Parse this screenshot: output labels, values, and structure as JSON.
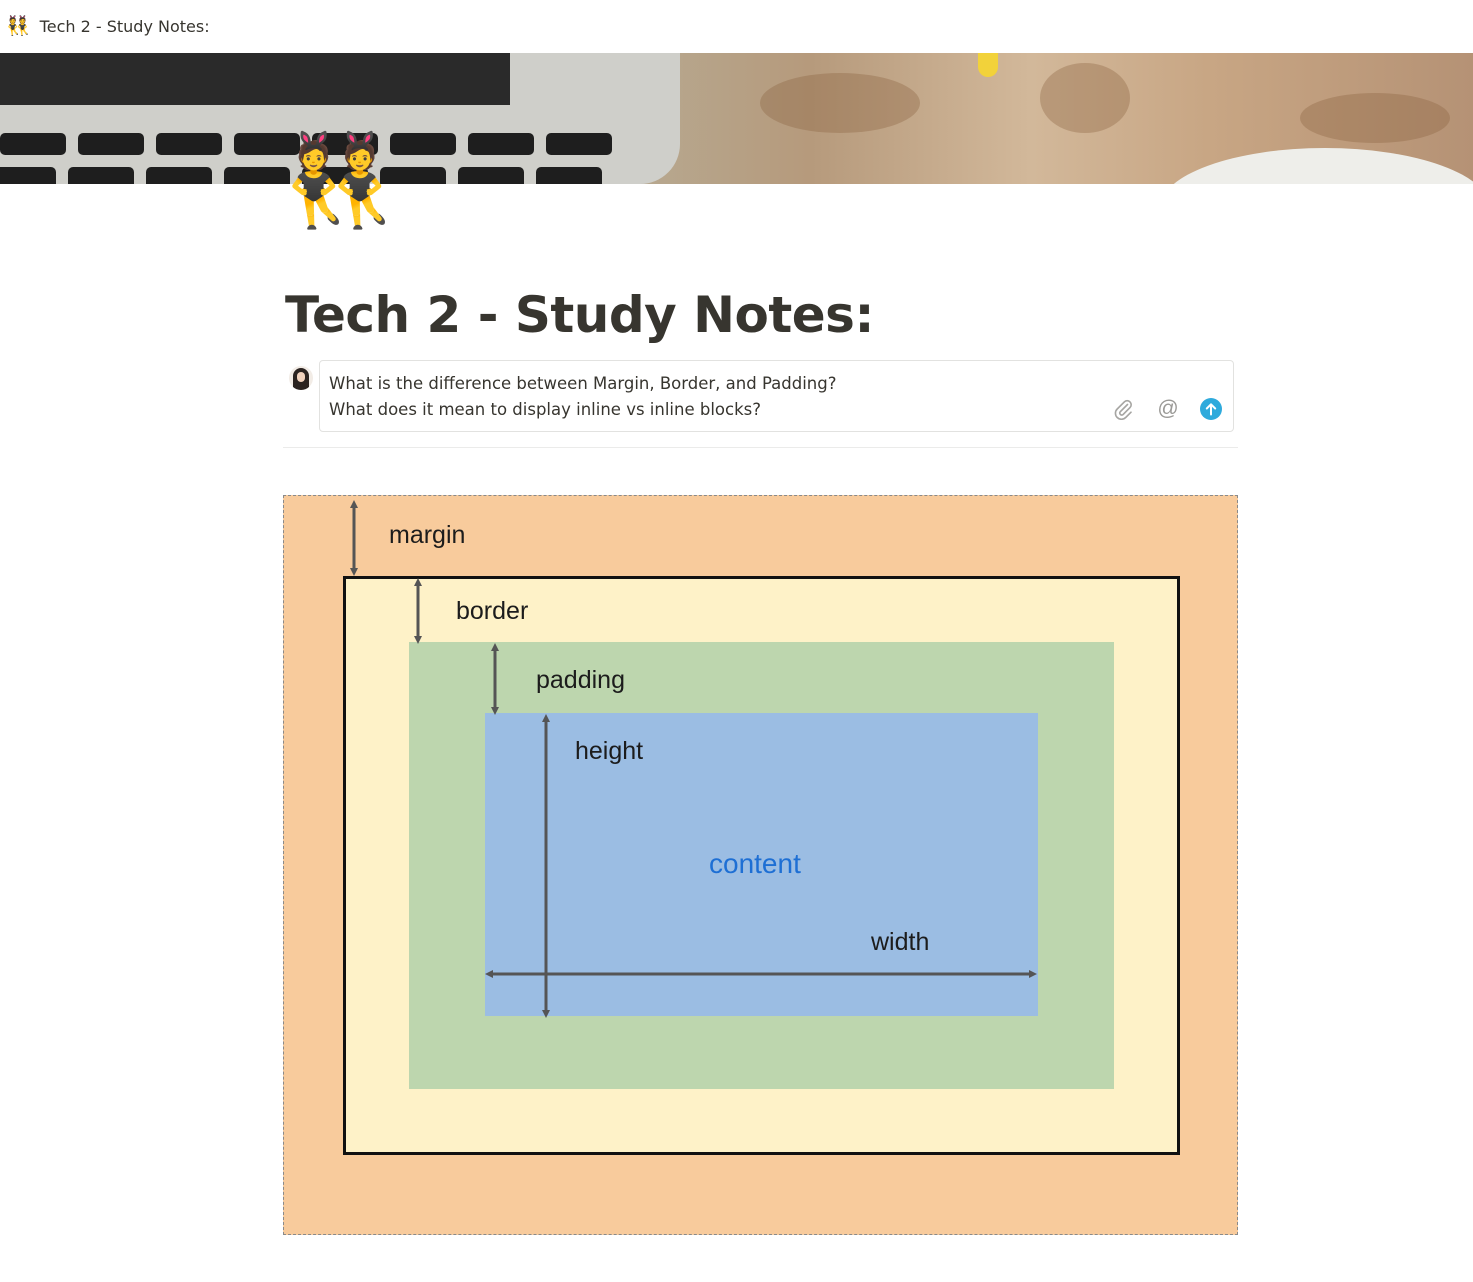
{
  "tab": {
    "icon": "👯",
    "title": "Tech 2 - Study Notes:"
  },
  "page": {
    "icon": "👯",
    "title": "Tech 2 - Study Notes:"
  },
  "comment": {
    "line1": "What is the difference between Margin, Border, and Padding?",
    "line2": "What does it mean to display inline vs inline blocks?",
    "attach_icon": "paperclip-icon",
    "mention_symbol": "@",
    "send_icon": "arrow-up-circle-icon"
  },
  "diagram": {
    "margin_label": "margin",
    "border_label": "border",
    "padding_label": "padding",
    "height_label": "height",
    "content_label": "content",
    "width_label": "width",
    "colors": {
      "margin": "#f8cb9c",
      "border": "#fef2c8",
      "padding": "#bdd6ae",
      "content": "#9bbde3",
      "content_text": "#1e6fd4"
    }
  },
  "colors": {
    "text": "#37352f",
    "send_button": "#2eaadc",
    "muted_icon": "#9b9a97"
  }
}
